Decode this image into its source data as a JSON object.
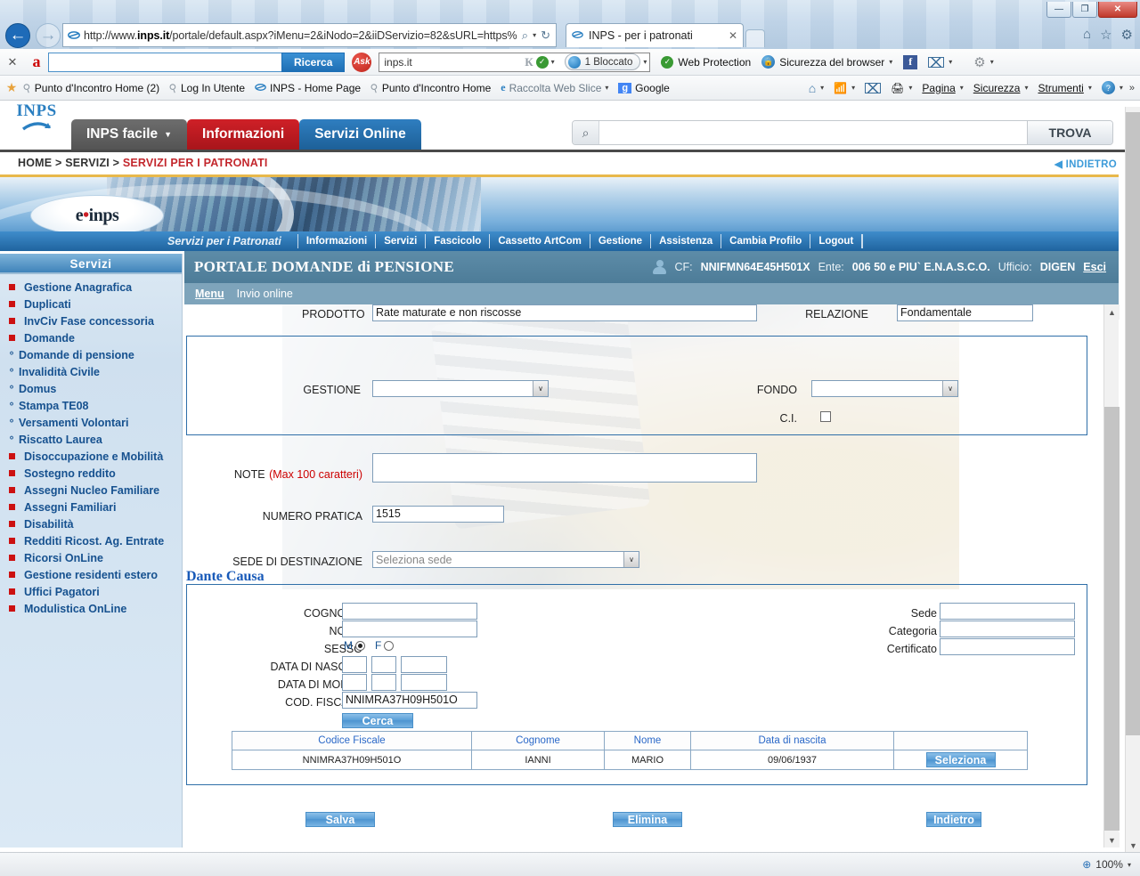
{
  "browser": {
    "address_url": "http://www.inps.it/portale/default.aspx?iMenu=2&iNodo=2&iiDServizio=82&sURL=https%",
    "url_bold": "inps.it",
    "url_prefix": "http://www.",
    "url_suffix": "/portale/default.aspx?iMenu=2&iNodo=2&iiDServizio=82&sURL=https%",
    "tab_title": "INPS - per i patronati",
    "tab_close": "✕",
    "win_minimize": "—",
    "win_restore": "❐",
    "win_close": "✕",
    "back_arrow": "←",
    "forward_arrow": "→",
    "search_caret": "▾",
    "refresh": "↻",
    "magnifier": "⌕"
  },
  "toolbar_ask": {
    "close_x": "✕",
    "logo": "a",
    "search_value": "",
    "search_button": "Ricerca",
    "ask_label": "Ask",
    "site_value": "inps.it",
    "blocked_label": "1 Bloccato",
    "web_protection": "Web Protection",
    "browser_security": "Sicurezza del browser",
    "facebook": "f",
    "caret": "▾"
  },
  "toolbar_favorites": {
    "items": [
      {
        "label": "Punto d'Incontro Home (2)",
        "icon": "pin-icon"
      },
      {
        "label": "Log In Utente",
        "icon": "pin-icon"
      },
      {
        "label": "INPS - Home Page",
        "icon": "ie-icon"
      },
      {
        "label": "Punto d'Incontro Home",
        "icon": "pin-icon"
      },
      {
        "label": "Raccolta Web Slice",
        "icon": "ie-icon"
      },
      {
        "label": "Google",
        "icon": "google-icon"
      }
    ],
    "right_items": [
      "Pagina",
      "Sicurezza",
      "Strumenti"
    ],
    "overflow": "»",
    "caret": "▾"
  },
  "site_header": {
    "logo_word": "INPS",
    "tabs": [
      {
        "label": "INPS facile",
        "style": "grey",
        "caret": "▼"
      },
      {
        "label": "Informazioni",
        "style": "red",
        "caret": ""
      },
      {
        "label": "Servizi Online",
        "style": "blue",
        "caret": ""
      }
    ],
    "search_placeholder": "",
    "search_value": "",
    "search_button": "TROVA",
    "breadcrumb": {
      "home": "HOME",
      "sep": ">",
      "servizi": "SERVIZI",
      "current": "SERVIZI PER I PATRONATI"
    },
    "back_link": "INDIETRO",
    "back_arrow": "◀"
  },
  "banner": {
    "logo_text": "e",
    "logo_dot": "•",
    "logo_suffix": "inps",
    "subtitle": "Servizi per i Patronati",
    "menu": [
      "Informazioni",
      "Servizi",
      "Fascicolo",
      "Cassetto ArtCom",
      "Gestione",
      "Assistenza",
      "Cambia Profilo",
      "Logout"
    ]
  },
  "portal": {
    "title": "PORTALE DOMANDE di PENSIONE",
    "cf_label": "CF:",
    "cf_value": "NNIFMN64E45H501X",
    "ente_label": "Ente:",
    "ente_value": "006 50 e PIU` E.N.A.S.C.O.",
    "ufficio_label": "Ufficio:",
    "ufficio_value": "DIGEN",
    "exit_link": "Esci",
    "sub_menu": "Menu",
    "sub_page": "Invio online"
  },
  "sidebar": {
    "title": "Servizi",
    "items": [
      {
        "label": "Gestione Anagrafica",
        "bullet": "square",
        "level": 1
      },
      {
        "label": "Duplicati",
        "bullet": "square",
        "level": 1
      },
      {
        "label": "InvCiv Fase concessoria",
        "bullet": "square",
        "level": 1
      },
      {
        "label": "Domande",
        "bullet": "square",
        "level": 1
      },
      {
        "label": "Domande di pensione",
        "bullet": "circle",
        "level": 2
      },
      {
        "label": "Invalidità Civile",
        "bullet": "circle",
        "level": 2
      },
      {
        "label": "Domus",
        "bullet": "circle",
        "level": 2
      },
      {
        "label": "Stampa TE08",
        "bullet": "circle",
        "level": 2
      },
      {
        "label": "Versamenti Volontari",
        "bullet": "circle",
        "level": 2
      },
      {
        "label": "Riscatto Laurea",
        "bullet": "circle",
        "level": 2
      },
      {
        "label": "Disoccupazione e Mobilità",
        "bullet": "square",
        "level": 1
      },
      {
        "label": "Sostegno reddito",
        "bullet": "square",
        "level": 1
      },
      {
        "label": "Assegni Nucleo Familiare",
        "bullet": "square",
        "level": 1
      },
      {
        "label": "Assegni Familiari",
        "bullet": "square",
        "level": 1
      },
      {
        "label": "Disabilità",
        "bullet": "square",
        "level": 1
      },
      {
        "label": "Redditi Ricost. Ag. Entrate",
        "bullet": "square",
        "level": 1
      },
      {
        "label": "Ricorsi OnLine",
        "bullet": "square",
        "level": 1
      },
      {
        "label": "Gestione residenti estero",
        "bullet": "square",
        "level": 1
      },
      {
        "label": "Uffici Pagatori",
        "bullet": "square",
        "level": 1
      },
      {
        "label": "Modulistica OnLine",
        "bullet": "square",
        "level": 1
      }
    ],
    "bullet_circle": "°"
  },
  "form": {
    "prodotto_label": "PRODOTTO",
    "prodotto_value": "Rate maturate e non riscosse",
    "relazione_label": "RELAZIONE",
    "relazione_value": "Fondamentale",
    "gestione_label": "GESTIONE",
    "gestione_value": "",
    "fondo_label": "FONDO",
    "fondo_value": "",
    "ci_label": "C.I.",
    "ci_checked": false,
    "note_label": "NOTE",
    "note_hint": "(Max 100 caratteri)",
    "note_value": "",
    "numero_pratica_label": "NUMERO PRATICA",
    "numero_pratica_value": "1515",
    "sede_destinazione_label": "SEDE DI DESTINAZIONE",
    "sede_destinazione_value": "Seleziona sede",
    "dropdown_arrow": "∨"
  },
  "dante_causa": {
    "title": "Dante Causa",
    "cognome_label": "COGNOME",
    "cognome_value": "",
    "nome_label": "NOME",
    "nome_value": "",
    "sesso_label": "SESSO",
    "sesso_m": "M",
    "sesso_f": "F",
    "sesso_selected": "M",
    "data_nascita_label": "DATA DI NASCITA",
    "data_nascita": [
      "",
      "",
      ""
    ],
    "data_morte_label": "DATA DI MORTE",
    "data_morte": [
      "",
      "",
      ""
    ],
    "cod_fiscale_label": "COD. FISCALE",
    "cod_fiscale_value": "NNIMRA37H09H501O",
    "cerca_button": "Cerca",
    "sede_label": "Sede",
    "sede_value": "",
    "categoria_label": "Categoria",
    "categoria_value": "",
    "certificato_label": "Certificato",
    "certificato_value": ""
  },
  "results_table": {
    "headers": [
      "Codice Fiscale",
      "Cognome",
      "Nome",
      "Data di nascita",
      ""
    ],
    "rows": [
      {
        "codice_fiscale": "NNIMRA37H09H501O",
        "cognome": "IANNI",
        "nome": "MARIO",
        "data_nascita": "09/06/1937",
        "action": "Seleziona"
      }
    ]
  },
  "actions": {
    "salva": "Salva",
    "elimina": "Elimina",
    "indietro": "Indietro"
  },
  "statusbar": {
    "zoom": "100%",
    "zoom_caret": "▾",
    "zoom_icon": "⊕"
  },
  "colors": {
    "accent_blue": "#2f7ec0",
    "accent_red": "#cf2027",
    "portal_header": "#4d7c98",
    "link_blue": "#16518f",
    "note_red": "#cc0000"
  }
}
